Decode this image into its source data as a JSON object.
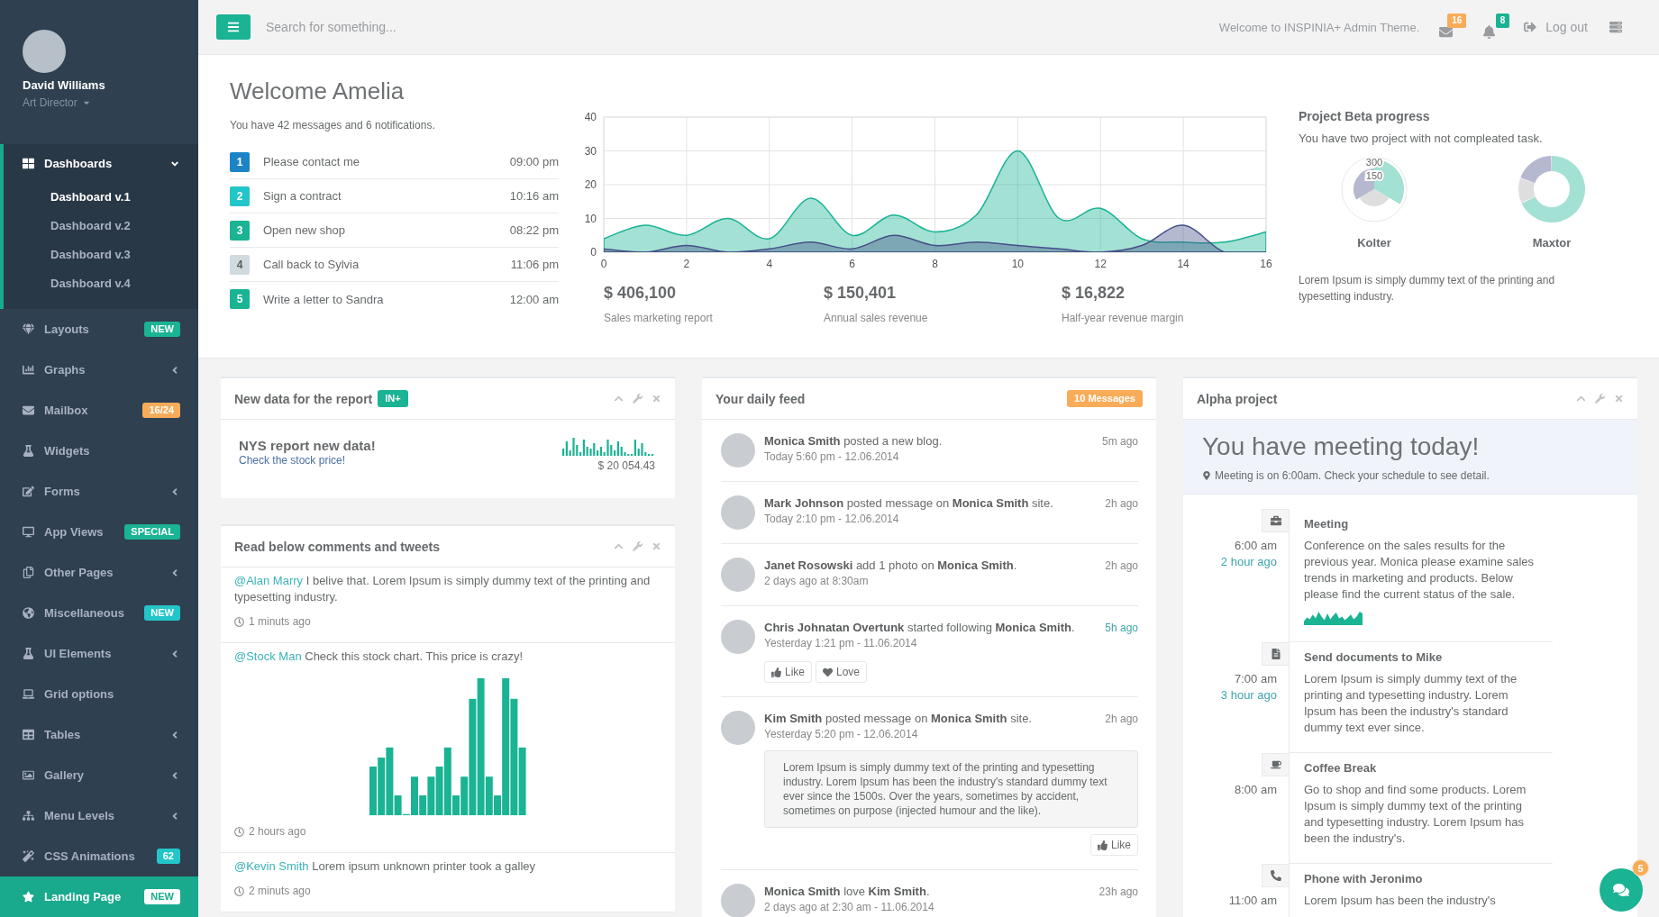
{
  "sidebar": {
    "profile": {
      "name": "David Williams",
      "role": "Art Director"
    },
    "items": [
      {
        "label": "Dashboards",
        "kind": "group",
        "selected": true,
        "expanded": true,
        "children": [
          {
            "label": "Dashboard v.1",
            "selected": true
          },
          {
            "label": "Dashboard v.2",
            "selected": false
          },
          {
            "label": "Dashboard v.3",
            "selected": false
          },
          {
            "label": "Dashboard v.4",
            "selected": false
          }
        ]
      },
      {
        "label": "Layouts",
        "kind": "link",
        "selected": false,
        "badge": {
          "text": "NEW",
          "color": "#1ab394"
        }
      },
      {
        "label": "Graphs",
        "kind": "group",
        "selected": false,
        "expanded": false
      },
      {
        "label": "Mailbox",
        "kind": "link",
        "selected": false,
        "badge": {
          "text": "16/24",
          "color": "#f8ac59"
        }
      },
      {
        "label": "Widgets",
        "kind": "link",
        "selected": false
      },
      {
        "label": "Forms",
        "kind": "group",
        "selected": false,
        "expanded": false
      },
      {
        "label": "App Views",
        "kind": "link",
        "selected": false,
        "badge": {
          "text": "SPECIAL",
          "color": "#1ab394"
        }
      },
      {
        "label": "Other Pages",
        "kind": "group",
        "selected": false,
        "expanded": false
      },
      {
        "label": "Miscellaneous",
        "kind": "link",
        "selected": false,
        "badge": {
          "text": "NEW",
          "color": "#23c6c8"
        }
      },
      {
        "label": "UI Elements",
        "kind": "group",
        "selected": false,
        "expanded": false
      },
      {
        "label": "Grid options",
        "kind": "link",
        "selected": false
      },
      {
        "label": "Tables",
        "kind": "group",
        "selected": false,
        "expanded": false
      },
      {
        "label": "Gallery",
        "kind": "group",
        "selected": false,
        "expanded": false
      },
      {
        "label": "Menu Levels",
        "kind": "group",
        "selected": false,
        "expanded": false
      },
      {
        "label": "CSS Animations",
        "kind": "link",
        "selected": false,
        "badge": {
          "text": "62",
          "color": "#23c6c8"
        }
      },
      {
        "label": "Landing Page",
        "kind": "landing",
        "selected": false,
        "badge": {
          "text": "NEW",
          "color": "#ffffff"
        }
      }
    ]
  },
  "topbar": {
    "search": {
      "placeholder": "Search for something..."
    },
    "welcome": "Welcome to INSPINIA+ Admin Theme.",
    "notifications": [
      {
        "count": "16",
        "color": "#f8ac59"
      },
      {
        "count": "8",
        "color": "#1ab394"
      }
    ],
    "logout": "Log out"
  },
  "welcome": {
    "title": "Welcome Amelia",
    "subtitle": "You have 42 messages and 6 notifications.",
    "tasks": [
      {
        "number": "1",
        "label": "Please contact me",
        "time": "09:00 pm",
        "color": "#1c84c6"
      },
      {
        "number": "2",
        "label": "Sign a contract",
        "time": "10:16 am",
        "color": "#23c6c8"
      },
      {
        "number": "3",
        "label": "Open new shop",
        "time": "08:22 pm",
        "color": "#1ab394"
      },
      {
        "number": "4",
        "label": "Call back to Sylvia",
        "time": "11:06 pm",
        "color": "#d1dade"
      },
      {
        "number": "5",
        "label": "Write a letter to Sandra",
        "time": "12:00 am",
        "color": "#1ab394"
      }
    ]
  },
  "sales": {
    "chart_data": {
      "type": "area",
      "x": [
        0,
        1,
        2,
        3,
        4,
        5,
        6,
        7,
        8,
        9,
        10,
        11,
        12,
        13,
        14,
        15,
        16
      ],
      "series": [
        {
          "color": "#1ab394",
          "values": [
            4,
            8,
            5,
            10,
            4,
            16,
            5,
            11,
            6,
            11,
            30,
            10,
            13,
            4,
            3,
            3,
            6
          ]
        },
        {
          "color": "#464f88",
          "values": [
            1,
            0,
            2,
            0,
            1,
            3,
            1,
            5,
            2,
            3,
            2,
            1,
            0,
            2,
            8,
            0,
            0
          ]
        }
      ],
      "xlim": [
        0,
        16
      ],
      "ylim": [
        0,
        40
      ],
      "xticks": [
        0,
        2,
        4,
        6,
        8,
        10,
        12,
        14,
        16
      ],
      "yticks": [
        0,
        10,
        20,
        30,
        40
      ],
      "stacked": false,
      "grid": true
    },
    "stats": [
      {
        "value": "$ 406,100",
        "label": "Sales marketing report"
      },
      {
        "value": "$ 150,401",
        "label": "Annual sales revenue"
      },
      {
        "value": "$ 16,822",
        "label": "Half-year revenue margin"
      }
    ]
  },
  "project_beta": {
    "title": "Project Beta progress",
    "subtitle": "You have two project with not compleated task.",
    "charts": [
      {
        "label": "Kolter",
        "kind": "polar",
        "scale_labels": [
          "300",
          "150"
        ]
      },
      {
        "label": "Maxtor",
        "kind": "donut"
      }
    ],
    "text": "Lorem Ipsum is simply dummy text of the printing and typesetting industry."
  },
  "report_panel": {
    "title": "New data for the report",
    "badge": "IN+",
    "headline": "NYS report new data!",
    "link": "Check the stock price!",
    "amount": "$ 20 054.43"
  },
  "comments_panel": {
    "title": "Read below comments and tweets",
    "comments": [
      {
        "kind": "text",
        "mention": "@Alan Marry",
        "text": "I belive that. Lorem Ipsum is simply dummy text of the printing and typesetting industry.",
        "time": "1 minuts ago"
      },
      {
        "kind": "chart",
        "mention": "@Stock Man",
        "text": "Check this stock chart. This price is crazy!",
        "time": "2 hours ago"
      },
      {
        "kind": "text",
        "mention": "@Kevin Smith",
        "text": "Lorem ipsum unknown printer took a galley",
        "time": "2 minuts ago"
      }
    ]
  },
  "feed_panel": {
    "title": "Your daily feed",
    "badge": "10 Messages",
    "items": [
      {
        "text": "**Monica Smith** posted a new blog.",
        "date": "Today 5:60 pm - 12.06.2014",
        "ago": "5m ago",
        "highlighted": false
      },
      {
        "text": "**Mark Johnson** posted message on **Monica Smith** site.",
        "date": "Today 2:10 pm - 12.06.2014",
        "ago": "2h ago",
        "highlighted": false
      },
      {
        "text": "**Janet Rosowski** add 1 photo on **Monica Smith**.",
        "date": "2 days ago at 8:30am",
        "ago": "2h ago",
        "highlighted": false
      },
      {
        "text": "**Chris Johnatan Overtunk** started following **Monica Smith**.",
        "date": "Yesterday 1:21 pm - 11.06.2014",
        "ago": "5h ago",
        "highlighted": true,
        "actions": [
          {
            "kind": "like",
            "label": "Like"
          },
          {
            "kind": "love",
            "label": "Love"
          }
        ]
      },
      {
        "text": "**Kim Smith** posted message on **Monica Smith** site.",
        "date": "Yesterday 5:20 pm - 12.06.2014",
        "ago": "2h ago",
        "highlighted": false,
        "quote": "Lorem Ipsum is simply dummy text of the printing and typesetting industry. Lorem Ipsum has been the industry's standard dummy text ever since the 1500s. Over the years, sometimes by accident, sometimes on purpose (injected humour and the like).",
        "actions": [
          {
            "kind": "like",
            "label": "Like"
          }
        ]
      },
      {
        "text": "**Monica Smith** love **Kim Smith**.",
        "date": "2 days ago at 2:30 am - 11.06.2014",
        "ago": "23h ago",
        "highlighted": false
      }
    ]
  },
  "alpha_panel": {
    "title": "Alpha project",
    "headline": "You have meeting today!",
    "note": "Meeting is on 6:00am. Check your schedule to see detail.",
    "timeline": [
      {
        "kind": "chart",
        "title": "Meeting",
        "time": "6:00 am",
        "ago": "2 hour ago",
        "text": "Conference on the sales results for the previous year. Monica please examine sales trends in marketing and products. Below please find the current status of the sale."
      },
      {
        "kind": "text",
        "title": "Send documents to Mike",
        "time": "7:00 am",
        "ago": "3 hour ago",
        "text": "Lorem Ipsum is simply dummy text of the printing and typesetting industry. Lorem Ipsum has been the industry's standard dummy text ever since."
      },
      {
        "kind": "text",
        "title": "Coffee Break",
        "time": "8:00 am",
        "text": "Go to shop and find some products. Lorem Ipsum is simply dummy text of the printing and typesetting industry. Lorem Ipsum has been the industry's."
      },
      {
        "kind": "text",
        "title": "Phone with Jeronimo",
        "time": "11:00 am",
        "text": "Lorem Ipsum has been the industry's"
      }
    ]
  },
  "chat": {
    "count": "5"
  }
}
